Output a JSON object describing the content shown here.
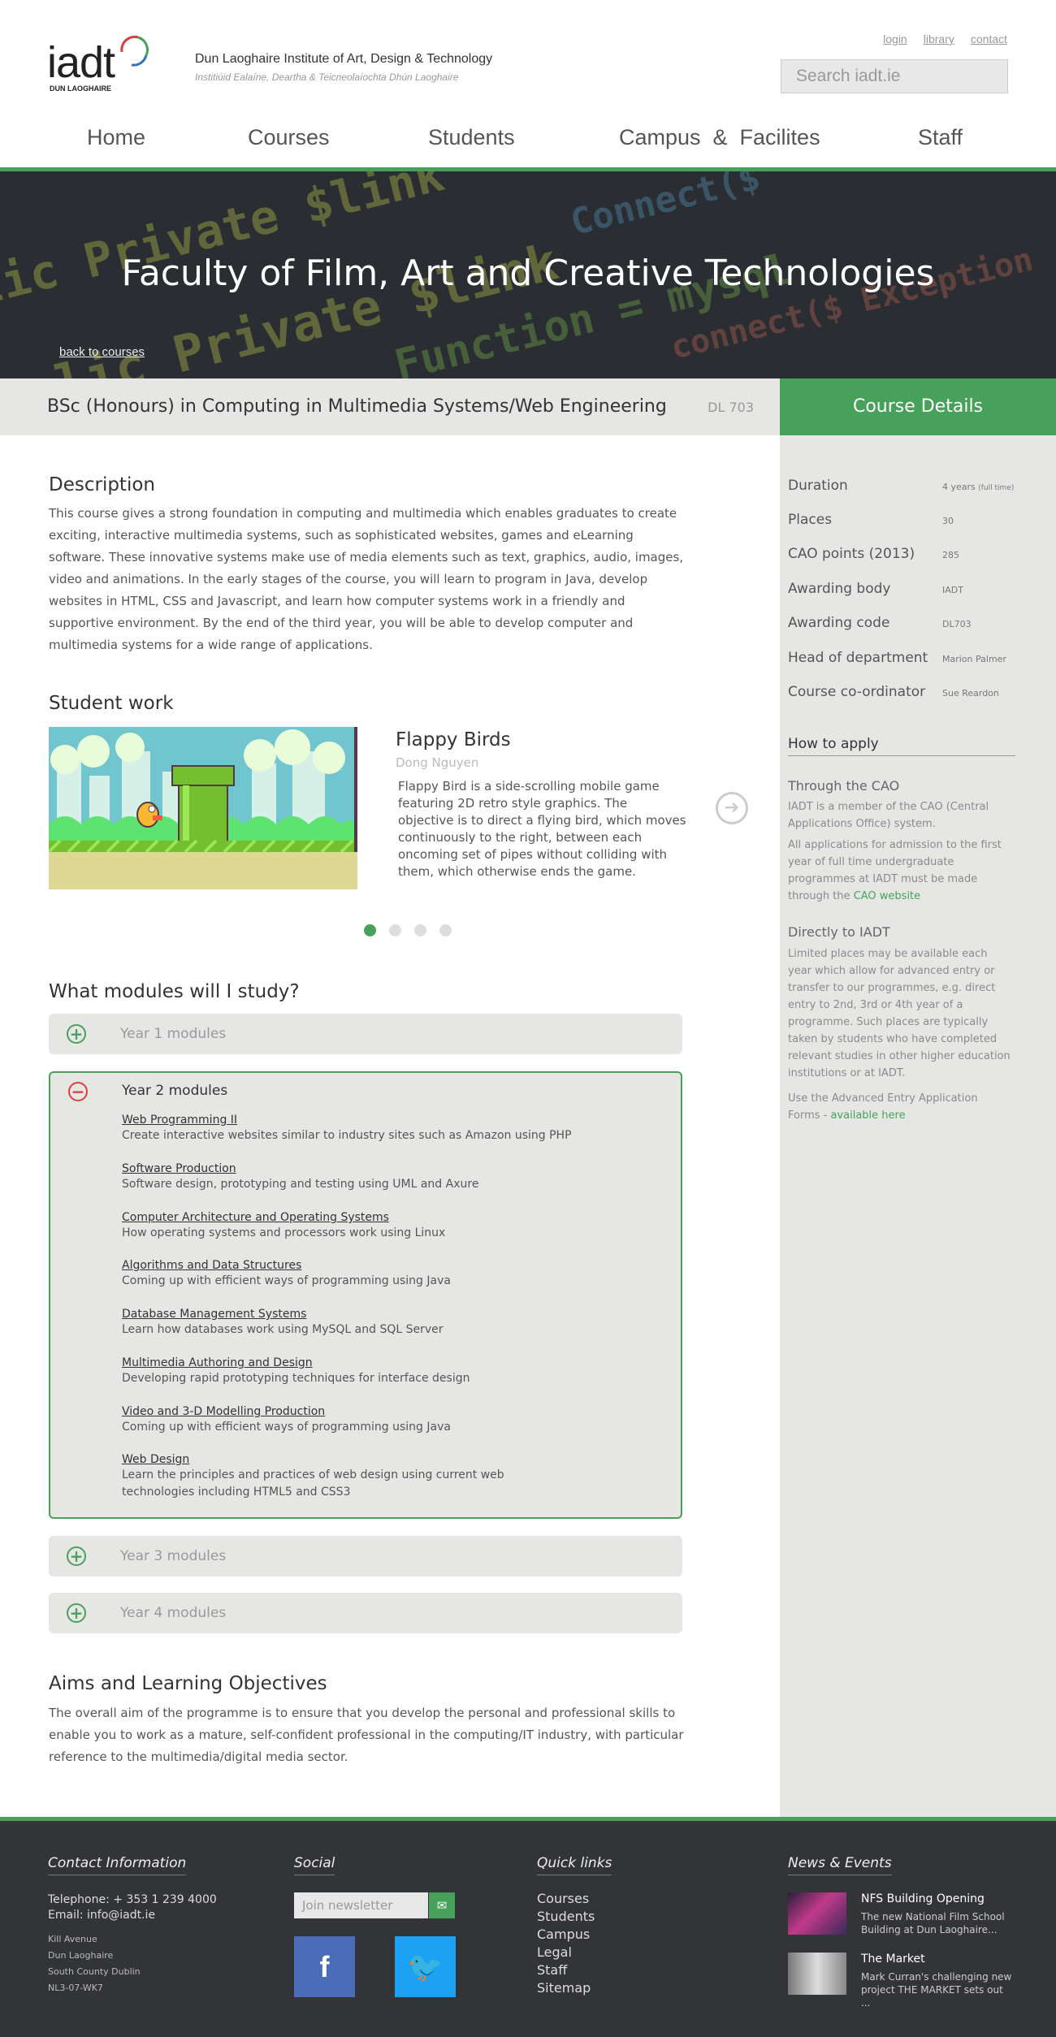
{
  "header": {
    "logo_text": "iadt",
    "logo_sub": "DUN LAOGHAIRE",
    "institute_name": "Dun Laoghaire Institute of Art, Design & Technology",
    "institute_irish": "Institiúid Ealaíne, Deartha & Teicneolaíochta Dhún Laoghaire",
    "top_links": [
      "login",
      "library",
      "contact"
    ],
    "search_placeholder": "Search iadt.ie"
  },
  "nav": [
    "Home",
    "Courses",
    "Students",
    "Campus  &  Facilites",
    "Staff"
  ],
  "hero": {
    "title": "Faculty of Film, Art and Creative Technologies",
    "back_link": "back to courses"
  },
  "course": {
    "title": "BSc (Honours) in Computing in Multimedia Systems/Web Engineering",
    "code": "DL 703"
  },
  "details": {
    "heading": "Course Details",
    "rows": [
      {
        "key": "Duration",
        "value": "4 years",
        "note": "(full time)"
      },
      {
        "key": "Places",
        "value": "30"
      },
      {
        "key": "CAO points (2013)",
        "value": "285"
      },
      {
        "key": "Awarding body",
        "value": "IADT"
      },
      {
        "key": "Awarding code",
        "value": "DL703"
      },
      {
        "key": "Head of department",
        "value": "Marion Palmer"
      },
      {
        "key": "Course co-ordinator",
        "value": "Sue Reardon"
      }
    ],
    "how_to_apply": "How to apply",
    "through_cao": "Through the CAO",
    "cao_p1": "IADT is a member of the CAO (Central Applications Office) system.",
    "cao_p2": "All applications for admission to the first year of full time undergraduate programmes at IADT must be made through the",
    "cao_link": "CAO website",
    "directly": "Directly to IADT",
    "direct_p": "Limited places may be available each year which allow for advanced entry or transfer to our programmes, e.g. direct entry to 2nd, 3rd or 4th year of a programme. Such places are typically taken by students who have completed relevant studies in other higher education institutions or at IADT.",
    "direct_p2": "Use the Advanced Entry Application Forms -",
    "direct_link": "available here"
  },
  "description": {
    "heading": "Description",
    "text": "This course gives a strong foundation in computing and multimedia which enables graduates to create exciting, interactive multimedia systems, such as sophisticated websites, games and eLearning software. These innovative systems make use of media elements such as text, graphics, audio, images, video and animations.  In the early stages of the course, you will learn to program in Java, develop websites in HTML, CSS and Javascript, and learn how computer systems work in a friendly and supportive environment.  By the end of the third year, you will be able to develop computer and multimedia systems for a wide range of applications."
  },
  "student_work": {
    "heading": "Student work",
    "title": "Flappy Birds",
    "author": "Dong Nguyen",
    "description": "Flappy Bird is a side-scrolling mobile game featuring 2D retro style graphics. The objective is to direct a flying bird, which moves continuously to the right, between each oncoming set of pipes without colliding with them, which otherwise ends the game.",
    "slides": 4,
    "active_slide": 1
  },
  "modules": {
    "heading": "What modules will I study?",
    "year1": "Year 1 modules",
    "year2": "Year 2 modules",
    "year3": "Year 3 modules",
    "year4": "Year 4 modules",
    "year2_items": [
      {
        "title": "Web Programming II",
        "desc": "Create interactive websites similar to industry sites such as Amazon using PHP"
      },
      {
        "title": "Software Production",
        "desc": "Software design, prototyping and testing using UML and Axure"
      },
      {
        "title": "Computer Architecture and Operating Systems",
        "desc": "How operating systems and processors work using Linux"
      },
      {
        "title": "Algorithms and Data Structures",
        "desc": "Coming up with efficient ways of programming using Java"
      },
      {
        "title": "Database Management Systems",
        "desc": "Learn how databases work using MySQL and SQL Server"
      },
      {
        "title": "Multimedia Authoring and Design",
        "desc": "Developing rapid prototyping techniques for interface design"
      },
      {
        "title": "Video and 3-D Modelling Production",
        "desc": "Coming up with efficient ways of programming using Java"
      },
      {
        "title": "Web Design",
        "desc": "Learn the principles and practices of web design using current web technologies including HTML5 and CSS3"
      }
    ]
  },
  "aims": {
    "heading": "Aims and Learning Objectives",
    "text": "The overall aim of the programme is to ensure that you develop the personal and professional skills to enable you to work as a mature, self-confident professional in the computing/IT industry, with particular reference to the multimedia/digital media sector."
  },
  "footer": {
    "contact_heading": "Contact Information",
    "telephone": "Telephone: + 353 1 239 4000",
    "email": "Email:  info@iadt.ie",
    "address": [
      "Kill Avenue",
      "Dun Laoghaire",
      "South County Dublin",
      "NL3-07-WK7"
    ],
    "social_heading": "Social",
    "newsletter_placeholder": "Join newsletter",
    "quick_heading": "Quick links",
    "quick_links": [
      "Courses",
      "Students",
      "Campus",
      "Legal",
      "Staff",
      "Sitemap"
    ],
    "news_heading": "News & Events",
    "news": [
      {
        "title": "NFS Building Opening",
        "desc": "The new National Film School Building at Dun Laoghaire..."
      },
      {
        "title": "The Market",
        "desc": "Mark Curran's challenging new project THE MARKET sets out ..."
      }
    ]
  },
  "colors": {
    "accent": "#48a15a",
    "collapse": "#d9403a",
    "sidebar": "#e6e7e5",
    "footer": "#333437"
  }
}
